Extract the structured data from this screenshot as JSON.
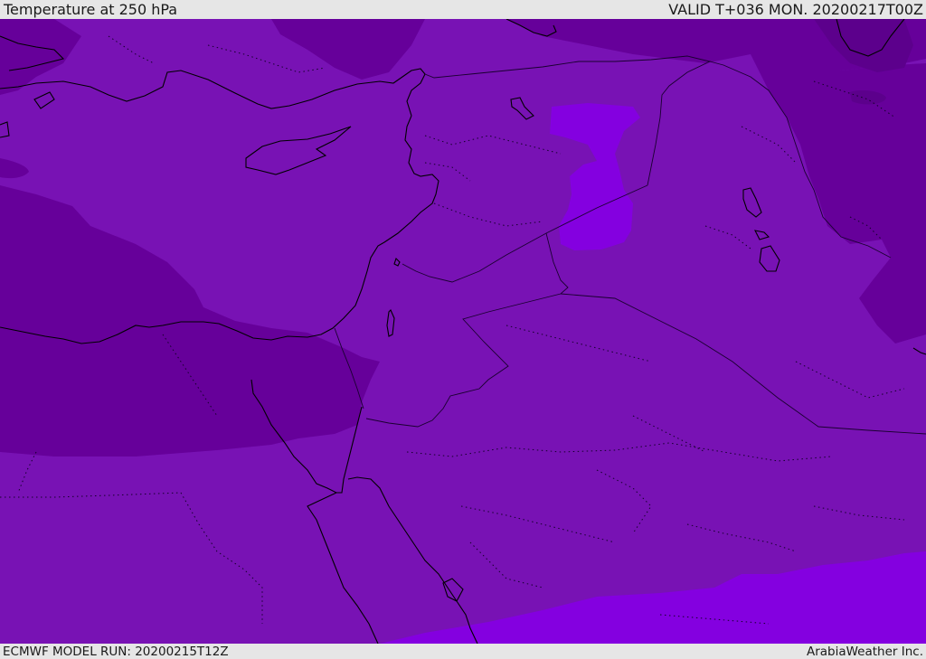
{
  "header": {
    "title": "Temperature at 250 hPa",
    "valid_time": "VALID T+036 MON. 20200217T00Z"
  },
  "footer": {
    "model_run": "ECMWF MODEL RUN: 20200215T12Z",
    "credit": "ArabiaWeather Inc."
  },
  "map": {
    "field": "Temperature at 250 hPa",
    "colors": {
      "base": "#7812b4",
      "cold": "#66009a",
      "colder": "#5c008c",
      "warm": "#8400e0",
      "coast": "#000000",
      "border": "#1a0030"
    }
  }
}
